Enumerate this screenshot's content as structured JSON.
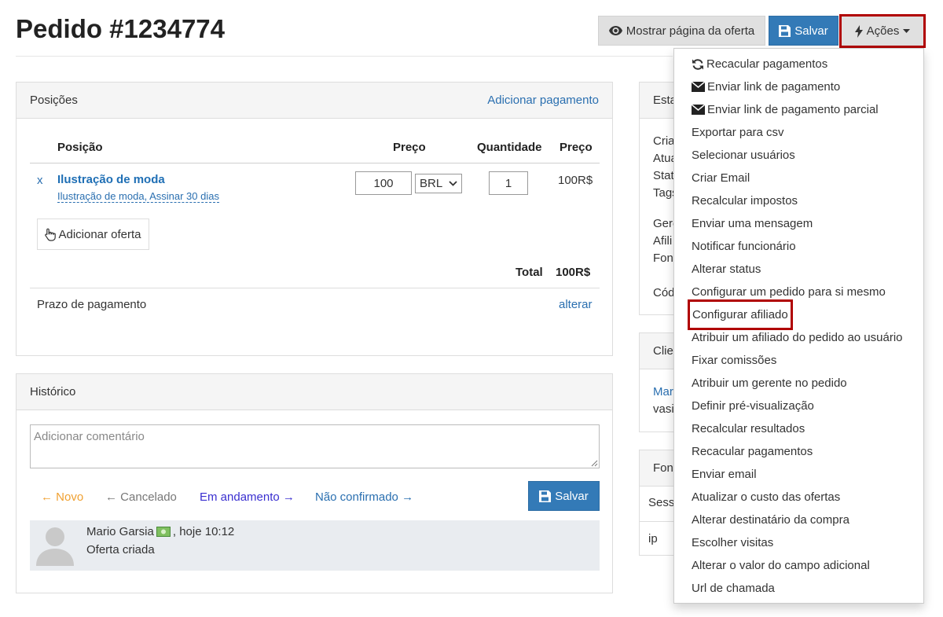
{
  "header": {
    "title": "Pedido #1234774",
    "view_offer_label": "Mostrar página da oferta",
    "save_label": "Salvar",
    "actions_label": "Ações"
  },
  "positions_panel": {
    "title": "Posições",
    "add_payment_link": "Adicionar pagamento",
    "columns": {
      "position": "Posição",
      "price": "Preço",
      "quantity": "Quantidade",
      "price_total": "Preço"
    },
    "row": {
      "remove": "x",
      "name": "Ilustração de moda",
      "subtitle": "Ilustração de moda, Assinar 30 dias",
      "price_value": "100",
      "currency": "BRL",
      "quantity": "1",
      "total": "100R$"
    },
    "add_offer_label": "Adicionar oferta",
    "total_label": "Total",
    "total_value": "100R$",
    "payment_term_label": "Prazo de pagamento",
    "change_link": "alterar"
  },
  "history_panel": {
    "title": "Histórico",
    "comment_placeholder": "Adicionar comentário",
    "statuses": [
      {
        "label": "Novo",
        "arrow": "←",
        "color": "#f0a030"
      },
      {
        "label": "Cancelado",
        "arrow": "←",
        "color": "#777777"
      },
      {
        "label": "Em andamento",
        "arrow": "→",
        "color": "#3a2fd0"
      },
      {
        "label": "Não confirmado",
        "arrow": "→",
        "color": "#2a6fb0"
      }
    ],
    "save_label": "Salvar",
    "entry": {
      "author": "Mario Garsia",
      "time": ", hoje 10:12",
      "text": "Oferta criada"
    }
  },
  "side": {
    "status_title": "Esta",
    "status_lines": [
      "Cria",
      "Atua",
      "Stat",
      "Tags",
      "Gere",
      "Afili",
      "Fon",
      "Cód"
    ],
    "client_title": "Clie",
    "client_lines": [
      "Mar",
      "vasi"
    ],
    "source_title": "Fon",
    "source_lines": [
      "Sess",
      "ip"
    ]
  },
  "actions_menu": [
    {
      "label": "Recacular pagamentos",
      "icon": "refresh-icon"
    },
    {
      "label": "Enviar link de pagamento",
      "icon": "envelope-icon"
    },
    {
      "label": "Enviar link de pagamento parcial",
      "icon": "envelope-icon"
    },
    {
      "label": "Exportar para csv"
    },
    {
      "label": "Selecionar usuários"
    },
    {
      "label": "Criar Email"
    },
    {
      "label": "Recalcular impostos"
    },
    {
      "label": "Enviar uma mensagem"
    },
    {
      "label": "Notificar funcionário"
    },
    {
      "label": "Alterar status"
    },
    {
      "label": "Configurar um pedido para si mesmo"
    },
    {
      "label": "Configurar afiliado",
      "highlight": true
    },
    {
      "label": "Atribuir um afiliado do pedido ao usuário"
    },
    {
      "label": "Fixar comissões"
    },
    {
      "label": "Atribuir um gerente no pedido"
    },
    {
      "label": "Definir pré-visualização"
    },
    {
      "label": "Recalcular resultados"
    },
    {
      "label": "Recacular pagamentos"
    },
    {
      "label": "Enviar email"
    },
    {
      "label": "Atualizar o custo das ofertas"
    },
    {
      "label": "Alterar destinatário da compra"
    },
    {
      "label": "Escolher visitas"
    },
    {
      "label": "Alterar o valor do campo adicional"
    },
    {
      "label": "Url de chamada"
    }
  ]
}
